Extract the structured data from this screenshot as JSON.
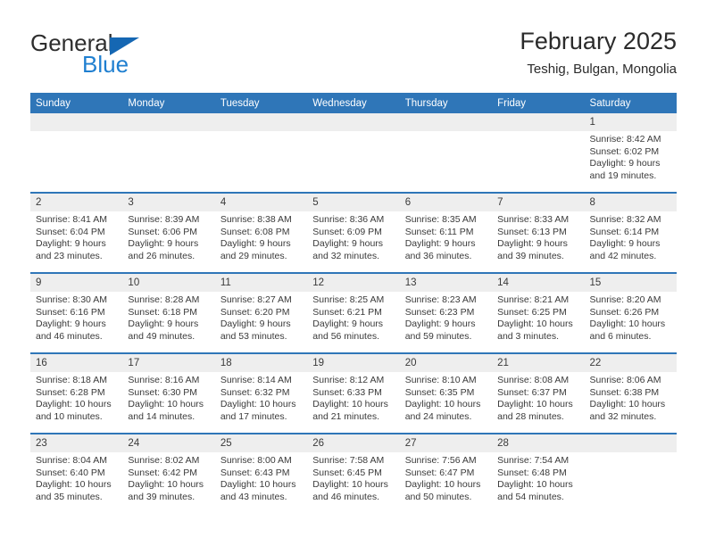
{
  "brand": {
    "name_top": "General",
    "name_bottom": "Blue",
    "triangle_color": "#1567b3",
    "blue_color": "#1f7fd0"
  },
  "header": {
    "title": "February 2025",
    "location": "Teshig, Bulgan, Mongolia"
  },
  "theme": {
    "header_blue": "#2f76b8",
    "daynum_band": "#eeeeee",
    "text": "#3a3a3a"
  },
  "weekdays": [
    "Sunday",
    "Monday",
    "Tuesday",
    "Wednesday",
    "Thursday",
    "Friday",
    "Saturday"
  ],
  "weeks": [
    [
      {
        "day": "",
        "sunrise": "",
        "sunset": "",
        "daylight_1": "",
        "daylight_2": ""
      },
      {
        "day": "",
        "sunrise": "",
        "sunset": "",
        "daylight_1": "",
        "daylight_2": ""
      },
      {
        "day": "",
        "sunrise": "",
        "sunset": "",
        "daylight_1": "",
        "daylight_2": ""
      },
      {
        "day": "",
        "sunrise": "",
        "sunset": "",
        "daylight_1": "",
        "daylight_2": ""
      },
      {
        "day": "",
        "sunrise": "",
        "sunset": "",
        "daylight_1": "",
        "daylight_2": ""
      },
      {
        "day": "",
        "sunrise": "",
        "sunset": "",
        "daylight_1": "",
        "daylight_2": ""
      },
      {
        "day": "1",
        "sunrise": "Sunrise: 8:42 AM",
        "sunset": "Sunset: 6:02 PM",
        "daylight_1": "Daylight: 9 hours",
        "daylight_2": "and 19 minutes."
      }
    ],
    [
      {
        "day": "2",
        "sunrise": "Sunrise: 8:41 AM",
        "sunset": "Sunset: 6:04 PM",
        "daylight_1": "Daylight: 9 hours",
        "daylight_2": "and 23 minutes."
      },
      {
        "day": "3",
        "sunrise": "Sunrise: 8:39 AM",
        "sunset": "Sunset: 6:06 PM",
        "daylight_1": "Daylight: 9 hours",
        "daylight_2": "and 26 minutes."
      },
      {
        "day": "4",
        "sunrise": "Sunrise: 8:38 AM",
        "sunset": "Sunset: 6:08 PM",
        "daylight_1": "Daylight: 9 hours",
        "daylight_2": "and 29 minutes."
      },
      {
        "day": "5",
        "sunrise": "Sunrise: 8:36 AM",
        "sunset": "Sunset: 6:09 PM",
        "daylight_1": "Daylight: 9 hours",
        "daylight_2": "and 32 minutes."
      },
      {
        "day": "6",
        "sunrise": "Sunrise: 8:35 AM",
        "sunset": "Sunset: 6:11 PM",
        "daylight_1": "Daylight: 9 hours",
        "daylight_2": "and 36 minutes."
      },
      {
        "day": "7",
        "sunrise": "Sunrise: 8:33 AM",
        "sunset": "Sunset: 6:13 PM",
        "daylight_1": "Daylight: 9 hours",
        "daylight_2": "and 39 minutes."
      },
      {
        "day": "8",
        "sunrise": "Sunrise: 8:32 AM",
        "sunset": "Sunset: 6:14 PM",
        "daylight_1": "Daylight: 9 hours",
        "daylight_2": "and 42 minutes."
      }
    ],
    [
      {
        "day": "9",
        "sunrise": "Sunrise: 8:30 AM",
        "sunset": "Sunset: 6:16 PM",
        "daylight_1": "Daylight: 9 hours",
        "daylight_2": "and 46 minutes."
      },
      {
        "day": "10",
        "sunrise": "Sunrise: 8:28 AM",
        "sunset": "Sunset: 6:18 PM",
        "daylight_1": "Daylight: 9 hours",
        "daylight_2": "and 49 minutes."
      },
      {
        "day": "11",
        "sunrise": "Sunrise: 8:27 AM",
        "sunset": "Sunset: 6:20 PM",
        "daylight_1": "Daylight: 9 hours",
        "daylight_2": "and 53 minutes."
      },
      {
        "day": "12",
        "sunrise": "Sunrise: 8:25 AM",
        "sunset": "Sunset: 6:21 PM",
        "daylight_1": "Daylight: 9 hours",
        "daylight_2": "and 56 minutes."
      },
      {
        "day": "13",
        "sunrise": "Sunrise: 8:23 AM",
        "sunset": "Sunset: 6:23 PM",
        "daylight_1": "Daylight: 9 hours",
        "daylight_2": "and 59 minutes."
      },
      {
        "day": "14",
        "sunrise": "Sunrise: 8:21 AM",
        "sunset": "Sunset: 6:25 PM",
        "daylight_1": "Daylight: 10 hours",
        "daylight_2": "and 3 minutes."
      },
      {
        "day": "15",
        "sunrise": "Sunrise: 8:20 AM",
        "sunset": "Sunset: 6:26 PM",
        "daylight_1": "Daylight: 10 hours",
        "daylight_2": "and 6 minutes."
      }
    ],
    [
      {
        "day": "16",
        "sunrise": "Sunrise: 8:18 AM",
        "sunset": "Sunset: 6:28 PM",
        "daylight_1": "Daylight: 10 hours",
        "daylight_2": "and 10 minutes."
      },
      {
        "day": "17",
        "sunrise": "Sunrise: 8:16 AM",
        "sunset": "Sunset: 6:30 PM",
        "daylight_1": "Daylight: 10 hours",
        "daylight_2": "and 14 minutes."
      },
      {
        "day": "18",
        "sunrise": "Sunrise: 8:14 AM",
        "sunset": "Sunset: 6:32 PM",
        "daylight_1": "Daylight: 10 hours",
        "daylight_2": "and 17 minutes."
      },
      {
        "day": "19",
        "sunrise": "Sunrise: 8:12 AM",
        "sunset": "Sunset: 6:33 PM",
        "daylight_1": "Daylight: 10 hours",
        "daylight_2": "and 21 minutes."
      },
      {
        "day": "20",
        "sunrise": "Sunrise: 8:10 AM",
        "sunset": "Sunset: 6:35 PM",
        "daylight_1": "Daylight: 10 hours",
        "daylight_2": "and 24 minutes."
      },
      {
        "day": "21",
        "sunrise": "Sunrise: 8:08 AM",
        "sunset": "Sunset: 6:37 PM",
        "daylight_1": "Daylight: 10 hours",
        "daylight_2": "and 28 minutes."
      },
      {
        "day": "22",
        "sunrise": "Sunrise: 8:06 AM",
        "sunset": "Sunset: 6:38 PM",
        "daylight_1": "Daylight: 10 hours",
        "daylight_2": "and 32 minutes."
      }
    ],
    [
      {
        "day": "23",
        "sunrise": "Sunrise: 8:04 AM",
        "sunset": "Sunset: 6:40 PM",
        "daylight_1": "Daylight: 10 hours",
        "daylight_2": "and 35 minutes."
      },
      {
        "day": "24",
        "sunrise": "Sunrise: 8:02 AM",
        "sunset": "Sunset: 6:42 PM",
        "daylight_1": "Daylight: 10 hours",
        "daylight_2": "and 39 minutes."
      },
      {
        "day": "25",
        "sunrise": "Sunrise: 8:00 AM",
        "sunset": "Sunset: 6:43 PM",
        "daylight_1": "Daylight: 10 hours",
        "daylight_2": "and 43 minutes."
      },
      {
        "day": "26",
        "sunrise": "Sunrise: 7:58 AM",
        "sunset": "Sunset: 6:45 PM",
        "daylight_1": "Daylight: 10 hours",
        "daylight_2": "and 46 minutes."
      },
      {
        "day": "27",
        "sunrise": "Sunrise: 7:56 AM",
        "sunset": "Sunset: 6:47 PM",
        "daylight_1": "Daylight: 10 hours",
        "daylight_2": "and 50 minutes."
      },
      {
        "day": "28",
        "sunrise": "Sunrise: 7:54 AM",
        "sunset": "Sunset: 6:48 PM",
        "daylight_1": "Daylight: 10 hours",
        "daylight_2": "and 54 minutes."
      },
      {
        "day": "",
        "sunrise": "",
        "sunset": "",
        "daylight_1": "",
        "daylight_2": ""
      }
    ]
  ]
}
